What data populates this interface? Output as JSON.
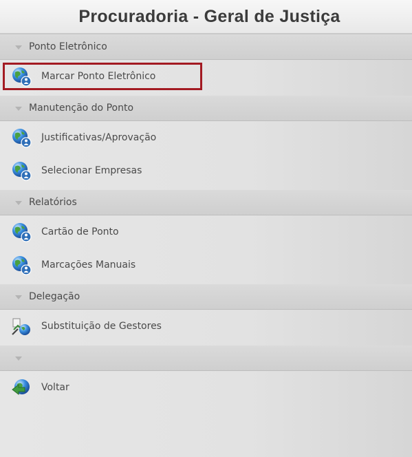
{
  "header": {
    "title": "Procuradoria - Geral de Justiça"
  },
  "sections": [
    {
      "title": "Ponto Eletrônico",
      "items": [
        {
          "label": "Marcar Ponto Eletrônico",
          "icon": "globe-user-icon"
        }
      ]
    },
    {
      "title": "Manutenção do Ponto",
      "items": [
        {
          "label": "Justificativas/Aprovação",
          "icon": "globe-user-icon"
        },
        {
          "label": "Selecionar Empresas",
          "icon": "globe-user-icon"
        }
      ]
    },
    {
      "title": "Relatórios",
      "items": [
        {
          "label": "Cartão de Ponto",
          "icon": "globe-user-icon"
        },
        {
          "label": "Marcações Manuais",
          "icon": "globe-user-icon"
        }
      ]
    },
    {
      "title": "Delegação",
      "items": [
        {
          "label": "Substituição de Gestores",
          "icon": "delegate-icon"
        }
      ]
    },
    {
      "title": "",
      "items": [
        {
          "label": "Voltar",
          "icon": "back-globe-icon"
        }
      ]
    }
  ],
  "colors": {
    "highlight": "#a31a22",
    "globe_blue": "#2b7bc9",
    "globe_green": "#4aa040"
  }
}
